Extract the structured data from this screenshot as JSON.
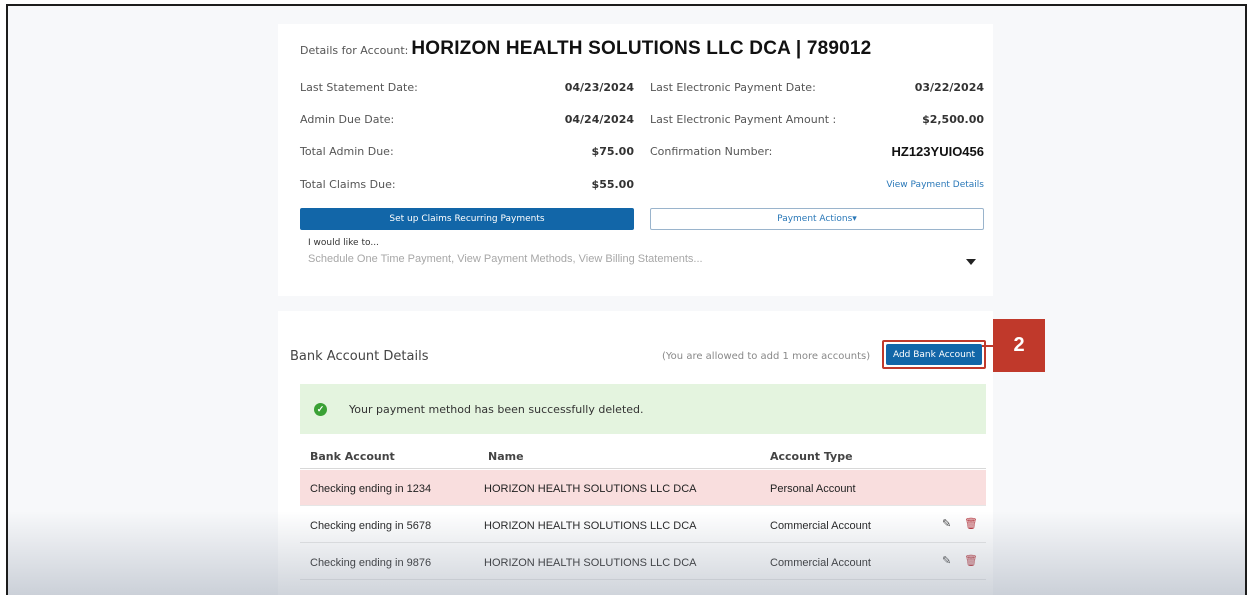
{
  "account": {
    "prefix": "Details for Account:",
    "name": "HORIZON HEALTH SOLUTIONS LLC DCA | 789012"
  },
  "summary_left": [
    {
      "label": "Last Statement Date:",
      "value": "04/23/2024"
    },
    {
      "label": "Admin Due Date:",
      "value": "04/24/2024"
    },
    {
      "label": "Total Admin Due:",
      "value": "$75.00"
    },
    {
      "label": "Total Claims Due:",
      "value": "$55.00"
    }
  ],
  "summary_right": [
    {
      "label": "Last Electronic Payment Date:",
      "value": "03/22/2024"
    },
    {
      "label": "Last Electronic Payment Amount :",
      "value": "$2,500.00"
    },
    {
      "label": "Confirmation Number:",
      "value": "HZ123YUIO456"
    }
  ],
  "view_payment_details": "View Payment Details",
  "buttons": {
    "recurring": "Set up Claims Recurring Payments",
    "payment_actions": "Payment Actions▾"
  },
  "select": {
    "label": "I would like to...",
    "placeholder": "Schedule One Time Payment, View Payment Methods, View Billing Statements..."
  },
  "bank": {
    "title": "Bank Account Details",
    "note": "(You are allowed to add 1 more accounts)",
    "add_button": "Add Bank Account",
    "callout_number": "2",
    "alert": "Your payment method has been successfully deleted.",
    "columns": [
      "Bank Account",
      "Name",
      "Account Type"
    ],
    "rows": [
      {
        "account": "Checking ending in 1234",
        "name": "HORIZON HEALTH SOLUTIONS LLC DCA",
        "type": "Personal Account"
      },
      {
        "account": "Checking ending in 5678",
        "name": "HORIZON HEALTH SOLUTIONS LLC DCA",
        "type": "Commercial Account"
      },
      {
        "account": "Checking ending in 9876",
        "name": "HORIZON HEALTH SOLUTIONS LLC DCA",
        "type": "Commercial Account"
      }
    ]
  },
  "colors": {
    "primary": "#1266a8",
    "highlight_row": "#f9dede",
    "alert_bg": "#e4f4df",
    "callout": "#c0392b"
  }
}
